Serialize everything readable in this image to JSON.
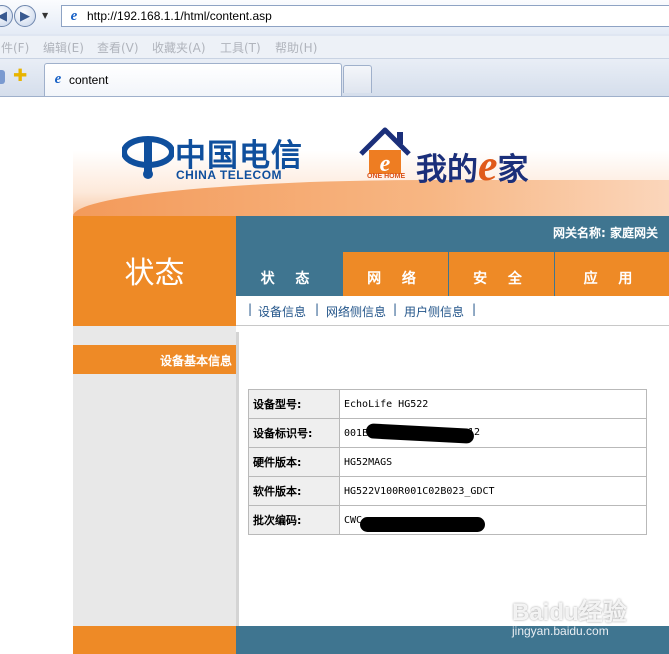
{
  "browser": {
    "url": "http://192.168.1.1/html/content.asp",
    "menu": [
      "件(F)",
      "编辑(E)",
      "查看(V)",
      "收藏夹(A)",
      "工具(T)",
      "帮助(H)"
    ],
    "tab_title": "content"
  },
  "banner": {
    "brand_cn": "中国电信",
    "brand_en": "CHINA TELECOM",
    "slogan_small": "ONE HOME",
    "slogan_prefix": "我的",
    "slogan_e": "e",
    "slogan_suffix": "家"
  },
  "sidebar": {
    "section_title": "状态",
    "item": "设备基本信息"
  },
  "header": {
    "gateway_label": "网关名称: 家庭网关"
  },
  "nav": {
    "tabs": [
      "状 态",
      "网 络",
      "安 全",
      "应 用"
    ],
    "active_tab": 0,
    "sub_links": [
      "设备信息",
      "网络侧信息",
      "用户侧信息"
    ]
  },
  "device_info": [
    {
      "label": "设备型号:",
      "value": "EchoLife HG522",
      "redacted": false
    },
    {
      "label": "设备标识号:",
      "value": "001E",
      "value_suffix": "12",
      "redacted": true
    },
    {
      "label": "硬件版本:",
      "value": "HG52MAGS",
      "redacted": false
    },
    {
      "label": "软件版本:",
      "value": "HG522V100R001C02B023_GDCT",
      "redacted": false
    },
    {
      "label": "批次编码:",
      "value": "CWC",
      "redacted": true
    }
  ],
  "watermark": {
    "brand": "Baidu经验",
    "url": "jingyan.baidu.com"
  },
  "colors": {
    "orange": "#ee8a26",
    "teal": "#3f7590",
    "brand_blue": "#0f4f9d"
  }
}
